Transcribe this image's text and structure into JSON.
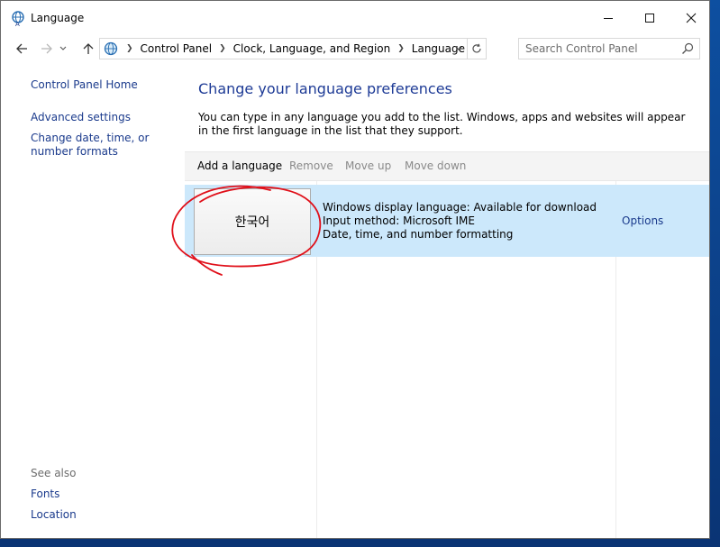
{
  "window": {
    "title": "Language",
    "minimize_icon": "minimize-icon",
    "maximize_icon": "maximize-icon",
    "close_icon": "close-icon"
  },
  "nav": {
    "back_icon": "back-arrow-icon",
    "forward_icon": "forward-arrow-icon",
    "up_icon": "up-arrow-icon",
    "breadcrumbs": [
      "Control Panel",
      "Clock, Language, and Region",
      "Language"
    ],
    "search_placeholder": "Search Control Panel"
  },
  "sidebar": {
    "home": "Control Panel Home",
    "advanced": "Advanced settings",
    "change_date": "Change date, time, or number formats",
    "see_also_label": "See also",
    "fonts": "Fonts",
    "location": "Location"
  },
  "main": {
    "heading": "Change your language preferences",
    "description": "You can type in any language you add to the list. Windows, apps and websites will appear in the first language in the list that they support."
  },
  "toolbar": {
    "add": "Add a language",
    "remove": "Remove",
    "move_up": "Move up",
    "move_down": "Move down"
  },
  "languages": [
    {
      "name": "한국어",
      "details": [
        "Windows display language: Available for download",
        "Input method: Microsoft IME",
        "Date, time, and number formatting"
      ],
      "options_label": "Options"
    }
  ],
  "colors": {
    "link": "#1a3a8c",
    "heading": "#1e3b96",
    "selection": "#cce8fb",
    "annotation": "#e0101a"
  }
}
